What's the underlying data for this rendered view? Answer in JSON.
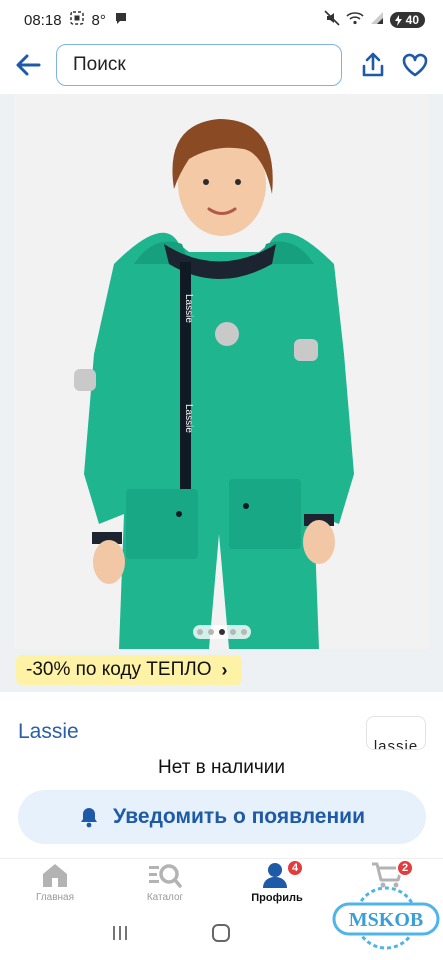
{
  "status_bar": {
    "time": "08:18",
    "temperature": "8°",
    "battery": "40"
  },
  "header": {
    "search_placeholder": "Поиск",
    "icons": [
      "back-arrow-icon",
      "share-icon",
      "heart-icon"
    ]
  },
  "gallery": {
    "slide_count": 5,
    "active_slide": 3
  },
  "promo": {
    "text": "-30% по коду ТЕПЛО",
    "chevron": "›"
  },
  "product": {
    "brand": "Lassie",
    "brand_logo_text": "lassie",
    "availability": "Нет в наличии",
    "notify_label": "Уведомить о появлении"
  },
  "bottom_nav": {
    "items": [
      {
        "label": "Главная",
        "icon": "home-icon"
      },
      {
        "label": "Каталог",
        "icon": "catalog-search-icon"
      },
      {
        "label": "Профиль",
        "icon": "profile-icon",
        "badge": "4",
        "active": true
      },
      {
        "label": "",
        "icon": "cart-icon",
        "badge": "2"
      }
    ]
  },
  "watermark": "MSKOB",
  "colors": {
    "accent": "#1e5aa8",
    "jumpsuit": "#1fb58f",
    "promo_bg": "#fdf2a6",
    "badge": "#e43b3b"
  }
}
